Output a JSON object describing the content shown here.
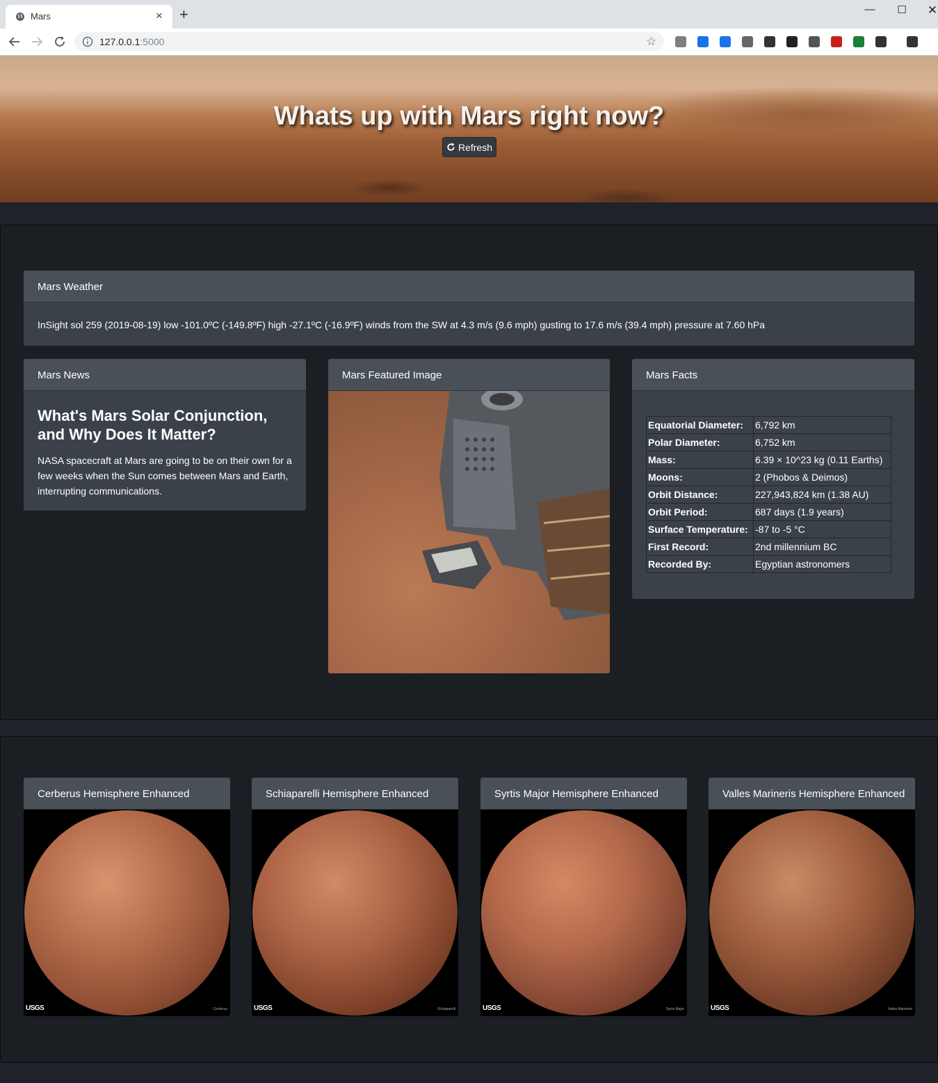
{
  "browser": {
    "tab_title": "Mars",
    "url_host": "127.0.0.1",
    "url_port": ":5000"
  },
  "hero": {
    "title": "Whats up with Mars right now?",
    "refresh_label": "Refresh"
  },
  "weather": {
    "header": "Mars Weather",
    "text": "InSight sol 259 (2019-08-19) low -101.0ºC (-149.8ºF) high -27.1ºC (-16.9ºF) winds from the SW at 4.3 m/s (9.6 mph) gusting to 17.6 m/s (39.4 mph) pressure at 7.60 hPa"
  },
  "news": {
    "header": "Mars News",
    "title": "What's Mars Solar Conjunction, and Why Does It Matter?",
    "body": "NASA spacecraft at Mars are going to be on their own for a few weeks when the Sun comes between Mars and Earth, interrupting communications."
  },
  "featured": {
    "header": "Mars Featured Image"
  },
  "facts": {
    "header": "Mars Facts",
    "rows": [
      {
        "key": "Equatorial Diameter:",
        "value": "6,792 km"
      },
      {
        "key": "Polar Diameter:",
        "value": "6,752 km"
      },
      {
        "key": "Mass:",
        "value": "6.39 × 10^23 kg (0.11 Earths)"
      },
      {
        "key": "Moons:",
        "value": "2 (Phobos & Deimos)"
      },
      {
        "key": "Orbit Distance:",
        "value": "227,943,824 km (1.38 AU)"
      },
      {
        "key": "Orbit Period:",
        "value": "687 days (1.9 years)"
      },
      {
        "key": "Surface Temperature:",
        "value": "-87 to -5 °C"
      },
      {
        "key": "First Record:",
        "value": "2nd millennium BC"
      },
      {
        "key": "Recorded By:",
        "value": "Egyptian astronomers"
      }
    ]
  },
  "hemispheres": [
    {
      "title": "Cerberus Hemisphere Enhanced",
      "logo": "USGS",
      "caption": "Cerberus"
    },
    {
      "title": "Schiaparelli Hemisphere Enhanced",
      "logo": "USGS",
      "caption": "Schiaparelli"
    },
    {
      "title": "Syrtis Major Hemisphere Enhanced",
      "logo": "USGS",
      "caption": "Syrtis Major"
    },
    {
      "title": "Valles Marineris Hemisphere Enhanced",
      "logo": "USGS",
      "caption": "Valles Marineris"
    }
  ],
  "icons": {
    "tab": "globe-icon",
    "nav": [
      "back-arrow-icon",
      "forward-arrow-icon",
      "reload-icon"
    ],
    "omnibox": [
      "info-icon",
      "star-icon"
    ],
    "refresh": "refresh-icon",
    "extensions": [
      "#7f7f7f",
      "#1a73e8",
      "#1a73e8",
      "#666666",
      "#333333",
      "#222222",
      "#555555",
      "#c5221f",
      "#188038",
      "#333333",
      "#333333"
    ]
  }
}
